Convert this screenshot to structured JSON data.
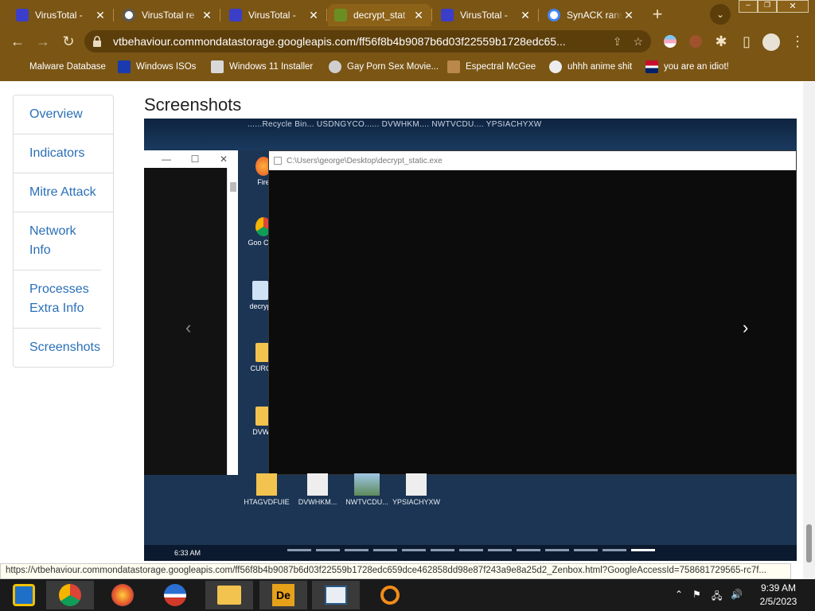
{
  "browser": {
    "tabs": [
      {
        "label": "VirusTotal - ",
        "icon": "virustotal-icon",
        "close": "✕"
      },
      {
        "label": "VirusTotal re",
        "icon": "globe-icon",
        "close": "✕"
      },
      {
        "label": "VirusTotal - ",
        "icon": "virustotal-icon",
        "close": "✕"
      },
      {
        "label": "decrypt_stat",
        "icon": "sandbox-icon",
        "close": "✕"
      },
      {
        "label": "VirusTotal - ",
        "icon": "virustotal-icon",
        "close": "✕"
      },
      {
        "label": "SynACK rans",
        "icon": "google-icon",
        "close": "✕"
      }
    ],
    "new_tab": "+",
    "url": "vtbehaviour.commondatastorage.googleapis.com/ff56f8b4b9087b6d03f22559b1728edc65...",
    "bookmarks": [
      {
        "label": "Malware Database"
      },
      {
        "label": "Windows ISOs"
      },
      {
        "label": "Windows 11 Installer"
      },
      {
        "label": "Gay Porn Sex Movie..."
      },
      {
        "label": "Espectral McGee"
      },
      {
        "label": "uhhh anime shit"
      },
      {
        "label": "you are an idiot!"
      }
    ],
    "status_url": "https://vtbehaviour.commondatastorage.googleapis.com/ff56f8b4b9087b6d03f22559b1728edc659dce462858dd98e87f243a9e8a25d2_Zenbox.html?GoogleAccessId=758681729565-rc7f..."
  },
  "page": {
    "nav": [
      {
        "label": "Overview"
      },
      {
        "label": "Indicators"
      },
      {
        "label": "Mitre Attack"
      },
      {
        "label": "Network Info"
      },
      {
        "label": "Processes Extra Info"
      },
      {
        "label": "Screenshots"
      }
    ],
    "section_title": "Screenshots",
    "carousel": {
      "desktop_top_names": "......Recycle Bin... USDNGYCO...... DVWHKM.... NWTVCDU.... YPSIACHYXW",
      "console_title": "C:\\Users\\george\\Desktop\\decrypt_static.exe",
      "left_window_controls": [
        "—",
        "☐",
        "✕"
      ],
      "desktop_icons": [
        {
          "label": "Fire"
        },
        {
          "label": "Goo Chro"
        },
        {
          "label": "decryp"
        },
        {
          "label": "CURQN"
        },
        {
          "label": "DVWH"
        }
      ],
      "bottom_icons": [
        {
          "label": "HTAGVDFUIE",
          "icon": "folder-icon"
        },
        {
          "label": "DVWHKM...",
          "icon": "docx-file-icon"
        },
        {
          "label": "NWTVCDU...",
          "icon": "image-file-icon"
        },
        {
          "label": "YPSIACHYXW",
          "icon": "mp3-file-icon"
        }
      ],
      "vm_time": "6:33 AM",
      "indicator_count_label": "",
      "prev": "‹",
      "next": "›"
    }
  },
  "taskbar": {
    "apps": [
      "virtualbox-icon",
      "chrome-icon",
      "firefox-icon",
      "obama-icon",
      "file-explorer-icon",
      "de-icon",
      "news-icon",
      "search-magnifier-icon"
    ],
    "time": "9:39 AM",
    "date": "2/5/2023"
  },
  "colors": {
    "chrome_frame": "#7a5514",
    "link_blue": "#2a6fb8",
    "taskbar": "#1a1a1a"
  }
}
